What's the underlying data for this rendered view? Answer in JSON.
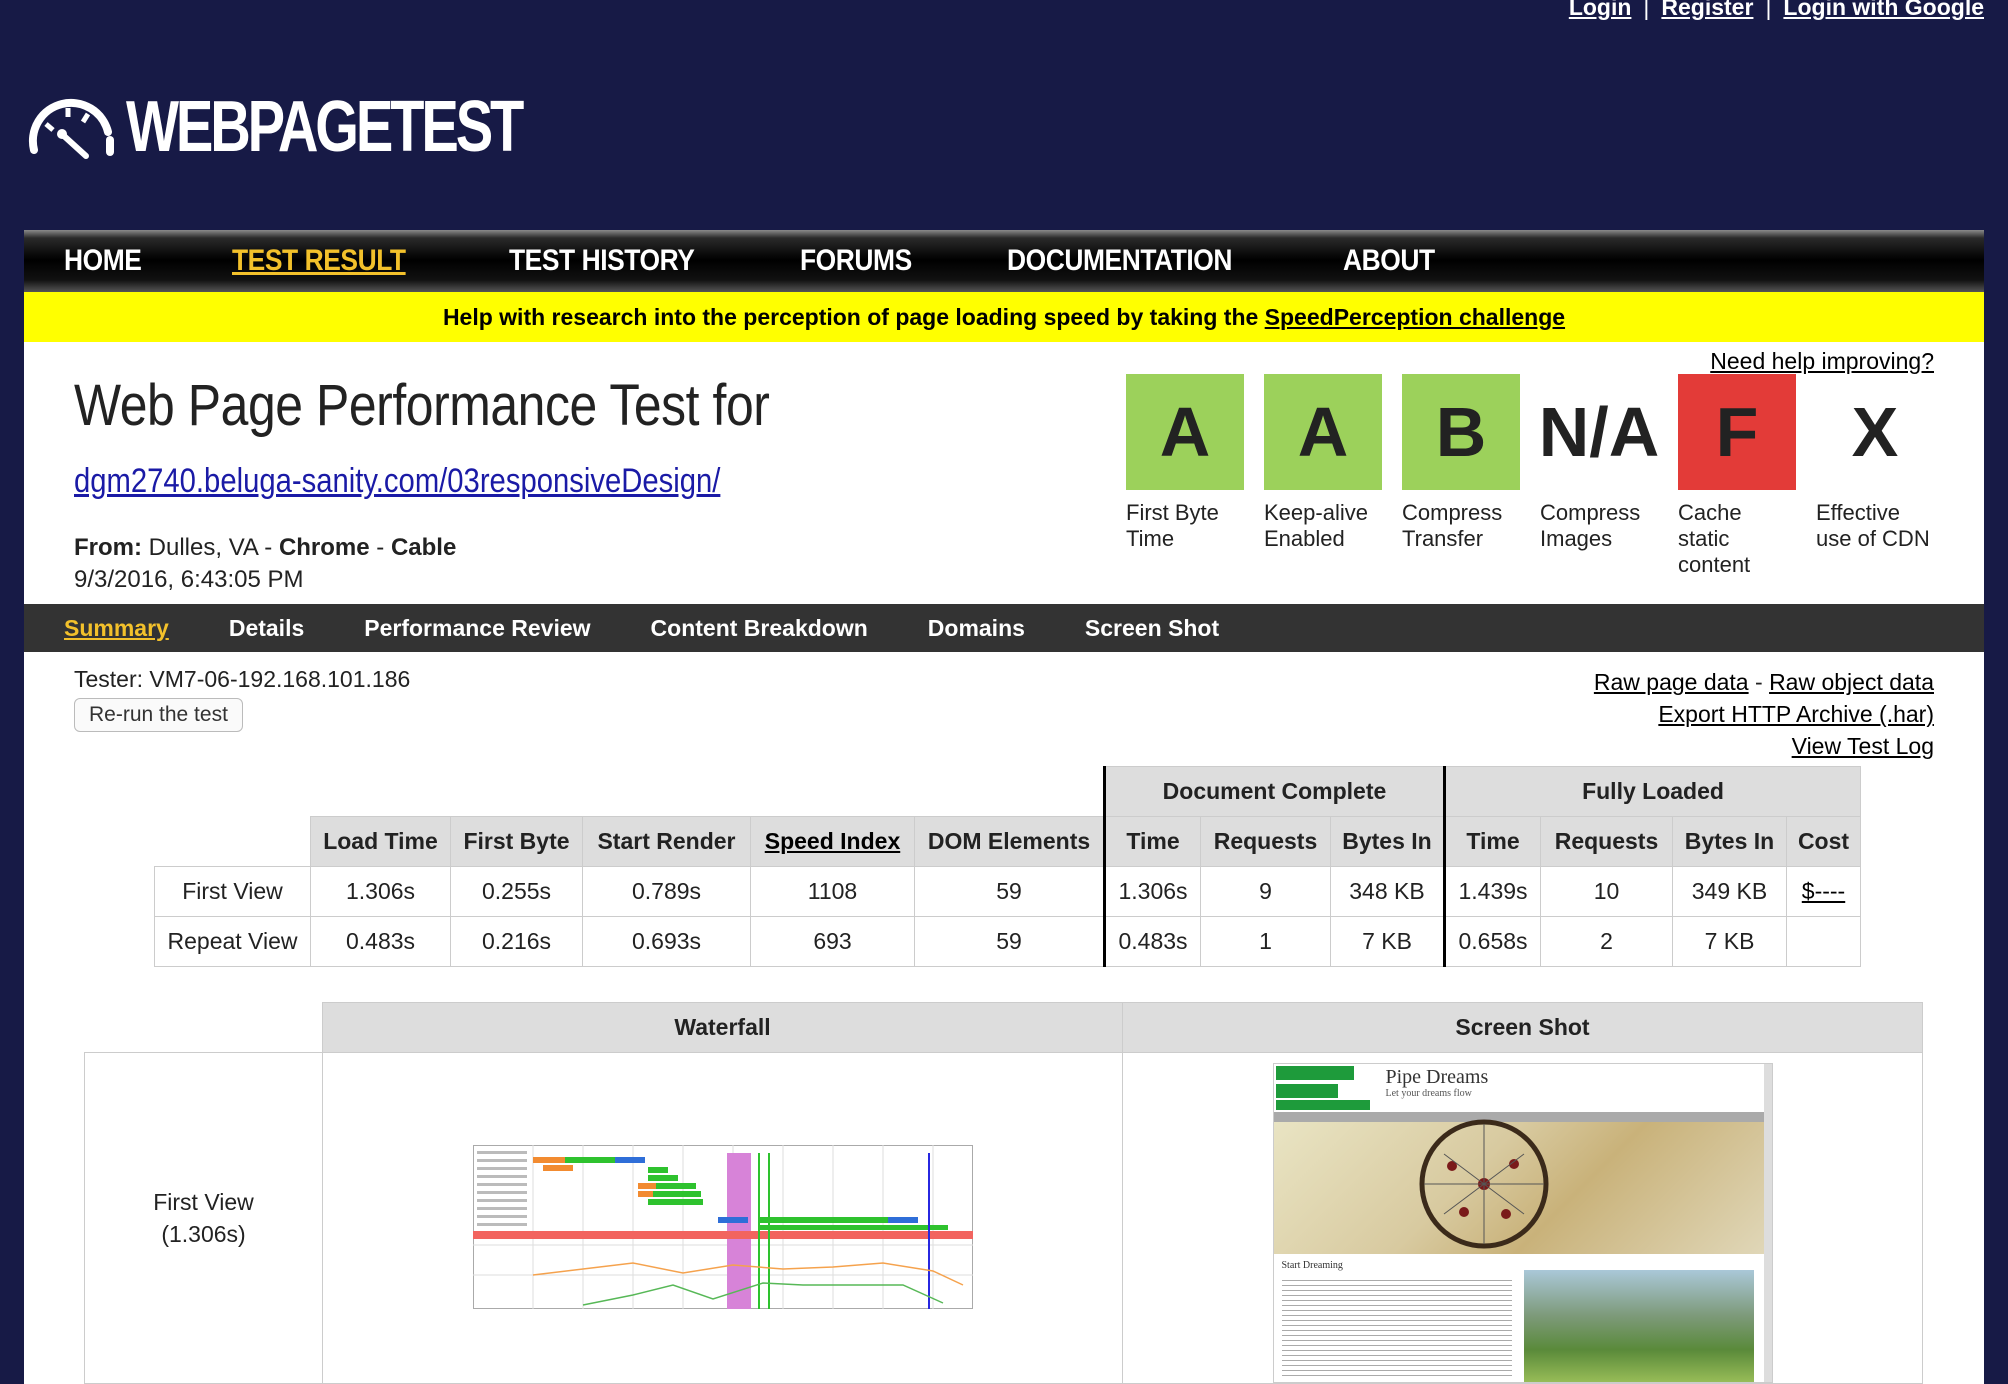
{
  "auth": {
    "login": "Login",
    "sep1": "|",
    "register": "Register",
    "sep2": "|",
    "google": "Login with Google"
  },
  "logo": {
    "text": "WEBPAGETEST"
  },
  "nav": [
    {
      "label": "HOME"
    },
    {
      "label": "TEST RESULT",
      "active": true
    },
    {
      "label": "TEST HISTORY"
    },
    {
      "label": "FORUMS"
    },
    {
      "label": "DOCUMENTATION"
    },
    {
      "label": "ABOUT"
    }
  ],
  "banner": {
    "text": "Help with research into the perception of page loading speed by taking the ",
    "link": "SpeedPerception challenge"
  },
  "header": {
    "title": "Web Page Performance Test for",
    "url": "dgm2740.beluga-sanity.com/03responsiveDesign/",
    "from_label": "From:",
    "location": " Dulles, VA - ",
    "browser": "Chrome",
    "dash": " - ",
    "connection": "Cable",
    "datetime": "9/3/2016, 6:43:05 PM",
    "need_help": "Need help improving?"
  },
  "grades": [
    {
      "grade": "A",
      "label1": "First Byte",
      "label2": "Time",
      "label3": "",
      "color": "#9cd15b"
    },
    {
      "grade": "A",
      "label1": "Keep-alive",
      "label2": "Enabled",
      "label3": "",
      "color": "#9cd15b"
    },
    {
      "grade": "B",
      "label1": "Compress",
      "label2": "Transfer",
      "label3": "",
      "color": "#9cd15b"
    },
    {
      "grade": "N/A",
      "label1": "Compress",
      "label2": "Images",
      "label3": "",
      "color": "none"
    },
    {
      "grade": "F",
      "label1": "Cache",
      "label2": "static",
      "label3": "content",
      "color": "#e33b38"
    },
    {
      "grade": "X",
      "label1": "Effective",
      "label2": "use of CDN",
      "label3": "",
      "color": "none"
    }
  ],
  "subnav": [
    {
      "label": "Summary",
      "active": true
    },
    {
      "label": "Details"
    },
    {
      "label": "Performance Review"
    },
    {
      "label": "Content Breakdown"
    },
    {
      "label": "Domains"
    },
    {
      "label": "Screen Shot"
    }
  ],
  "summary": {
    "tester": "Tester: VM7-06-192.168.101.186",
    "rerun": "Re-run the test",
    "raw_page": "Raw page data",
    "raw_dash": " - ",
    "raw_object": "Raw object data",
    "export_har": "Export HTTP Archive (.har)",
    "view_log": "View Test Log"
  },
  "results": {
    "group_doc": "Document Complete",
    "group_full": "Fully Loaded",
    "headers": [
      "Load Time",
      "First Byte",
      "Start Render",
      "Speed Index",
      "DOM Elements",
      "Time",
      "Requests",
      "Bytes In",
      "Time",
      "Requests",
      "Bytes In",
      "Cost"
    ],
    "rows": [
      {
        "label": "First View",
        "cells": [
          "1.306s",
          "0.255s",
          "0.789s",
          "1108",
          "59",
          "1.306s",
          "9",
          "348 KB",
          "1.439s",
          "10",
          "349 KB",
          "$----"
        ]
      },
      {
        "label": "Repeat View",
        "cells": [
          "0.483s",
          "0.216s",
          "0.693s",
          "693",
          "59",
          "0.483s",
          "1",
          "7 KB",
          "0.658s",
          "2",
          "7 KB",
          ""
        ]
      }
    ]
  },
  "media": {
    "waterfall": "Waterfall",
    "screenshot": "Screen Shot",
    "row_label": "First View",
    "row_time": "(1.306s)",
    "shot_title": "Pipe Dreams",
    "shot_sub": "Let your dreams flow",
    "shot_heading": "Start Dreaming"
  }
}
